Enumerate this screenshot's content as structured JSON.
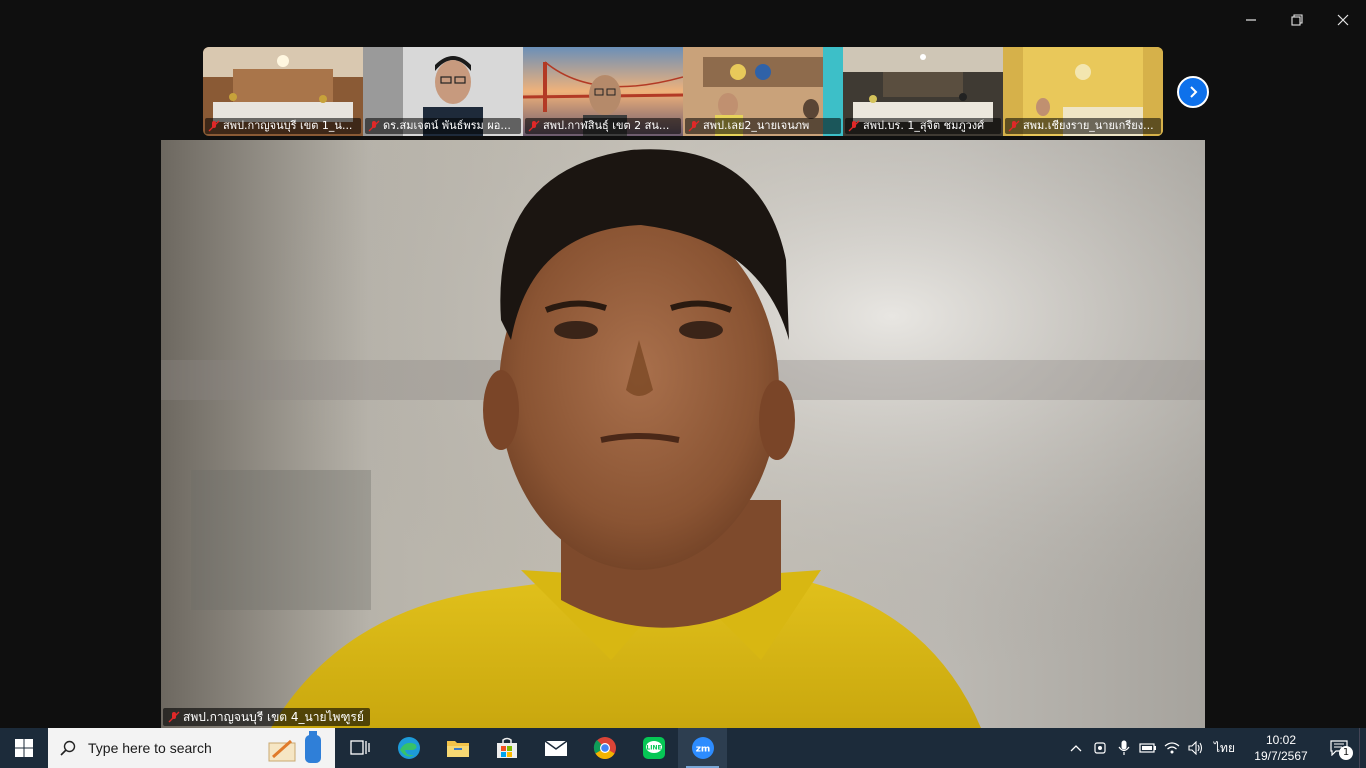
{
  "window": {
    "controls": [
      "minimize",
      "restore",
      "close"
    ]
  },
  "participants_strip": [
    {
      "name": "สพป.กาญจนบุรี เขต 1_น...",
      "muted": true,
      "bg": "meeting-hall"
    },
    {
      "name": "ดร.สมเจตน์ พันธ์พรม ผอ...",
      "muted": true,
      "bg": "person-glasses"
    },
    {
      "name": "สพป.กาฬสินธุ์ เขต 2 สน...",
      "muted": true,
      "bg": "golden-gate"
    },
    {
      "name": "สพป.เลย2_นายเจนภพ",
      "muted": true,
      "bg": "office-logos"
    },
    {
      "name": "สพป.บร. 1_สุจิต ชมภูวงศ์",
      "muted": true,
      "bg": "conference-room"
    },
    {
      "name": "สพม.เชียงราย_นายเกรียง...",
      "muted": true,
      "bg": "yellow-wall"
    }
  ],
  "main_video": {
    "name": "สพป.กาญจนบุรี เขต 4_นายไพฑูรย์",
    "muted": true
  },
  "taskbar": {
    "search_placeholder": "Type here to search",
    "apps": [
      "task-view",
      "edge",
      "file-explorer",
      "microsoft-store",
      "mail",
      "chrome",
      "line",
      "zoom"
    ],
    "language": "ไทย",
    "time": "10:02",
    "date": "19/7/2567",
    "notification_count": "1"
  },
  "colors": {
    "zoom_blue": "#0e71eb",
    "taskbar": "#1c2b3a",
    "mute_red": "#e02828"
  }
}
